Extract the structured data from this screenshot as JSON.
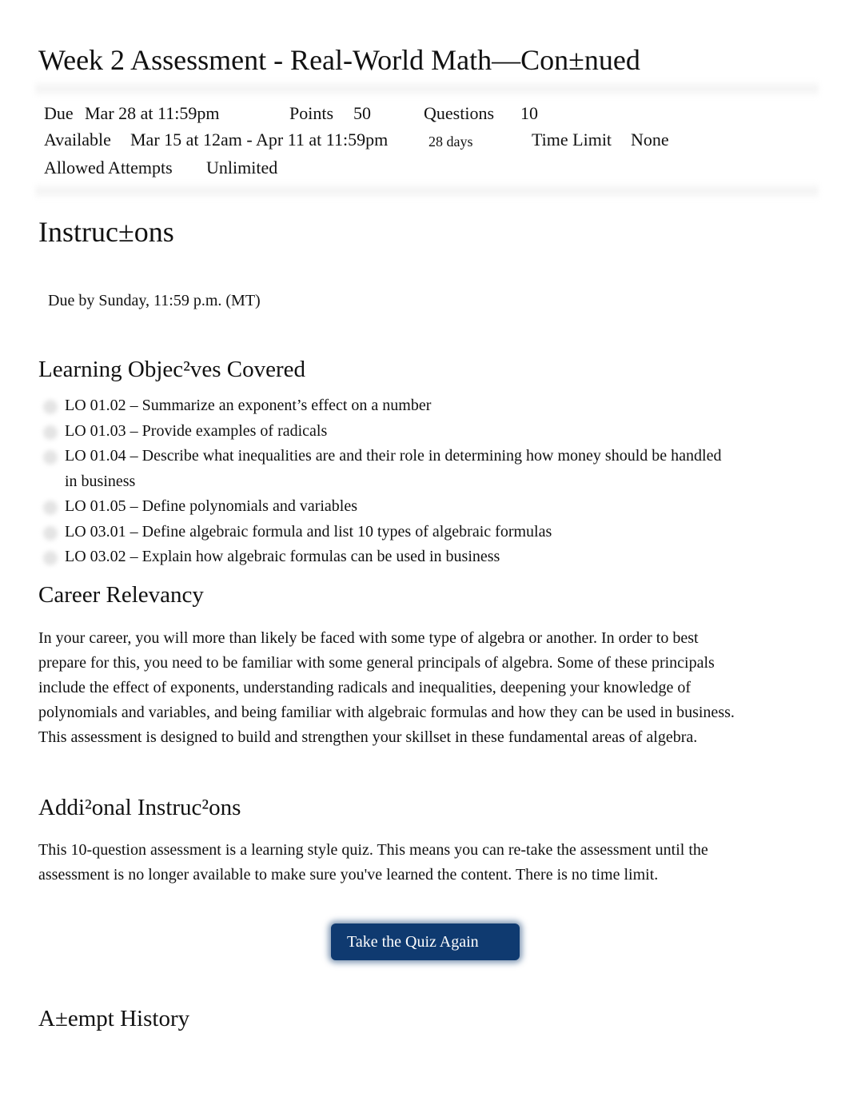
{
  "page": {
    "title": "Week 2 Assessment - Real-World Math—Con±nued"
  },
  "meta": {
    "due_label": "Due",
    "due_value": "Mar 28 at 11:59pm",
    "points_label": "Points",
    "points_value": "50",
    "questions_label": "Questions",
    "questions_value": "10",
    "available_label": "Available",
    "available_value": "Mar 15 at 12am - Apr 11 at 11:59pm",
    "available_duration": "28 days",
    "time_limit_label": "Time Limit",
    "time_limit_value": "None",
    "attempts_label": "Allowed Attempts",
    "attempts_value": "Unlimited"
  },
  "instructions": {
    "heading": "Instruc±ons",
    "due_note": "Due by Sunday, 11:59 p.m. (MT)"
  },
  "objectives": {
    "heading": "Learning Objec²ves Covered",
    "items": [
      "LO 01.02 – Summarize an exponent’s effect on a number",
      "LO 01.03 – Provide examples of radicals",
      "LO 01.04 – Describe what inequalities are and their role in determining how money should be handled in business",
      "LO 01.05 – Define polynomials and variables",
      "LO 03.01 – Define algebraic formula and list 10 types of algebraic formulas",
      "LO 03.02 – Explain how algebraic formulas can be used in business"
    ]
  },
  "career": {
    "heading": "Career Relevancy",
    "body": "In your career, you will more than likely be faced with some type of algebra or another. In order to best prepare for this, you need to be familiar with some general principals of algebra. Some of these principals include the effect of exponents, understanding radicals and inequalities, deepening your knowledge of polynomials and variables, and being familiar with algebraic formulas and how they can be used in business. This assessment is designed to build and strengthen your skillset in these fundamental areas of algebra."
  },
  "additional": {
    "heading": "Addi²onal Instruc²ons",
    "body": "This 10-question assessment is a learning style quiz. This means you can re-take the assessment until the assessment is no longer available to make sure you've learned the content. There is no time limit."
  },
  "actions": {
    "retake_label": "Take the Quiz Again"
  },
  "attempt_history": {
    "heading": "A±empt History"
  }
}
